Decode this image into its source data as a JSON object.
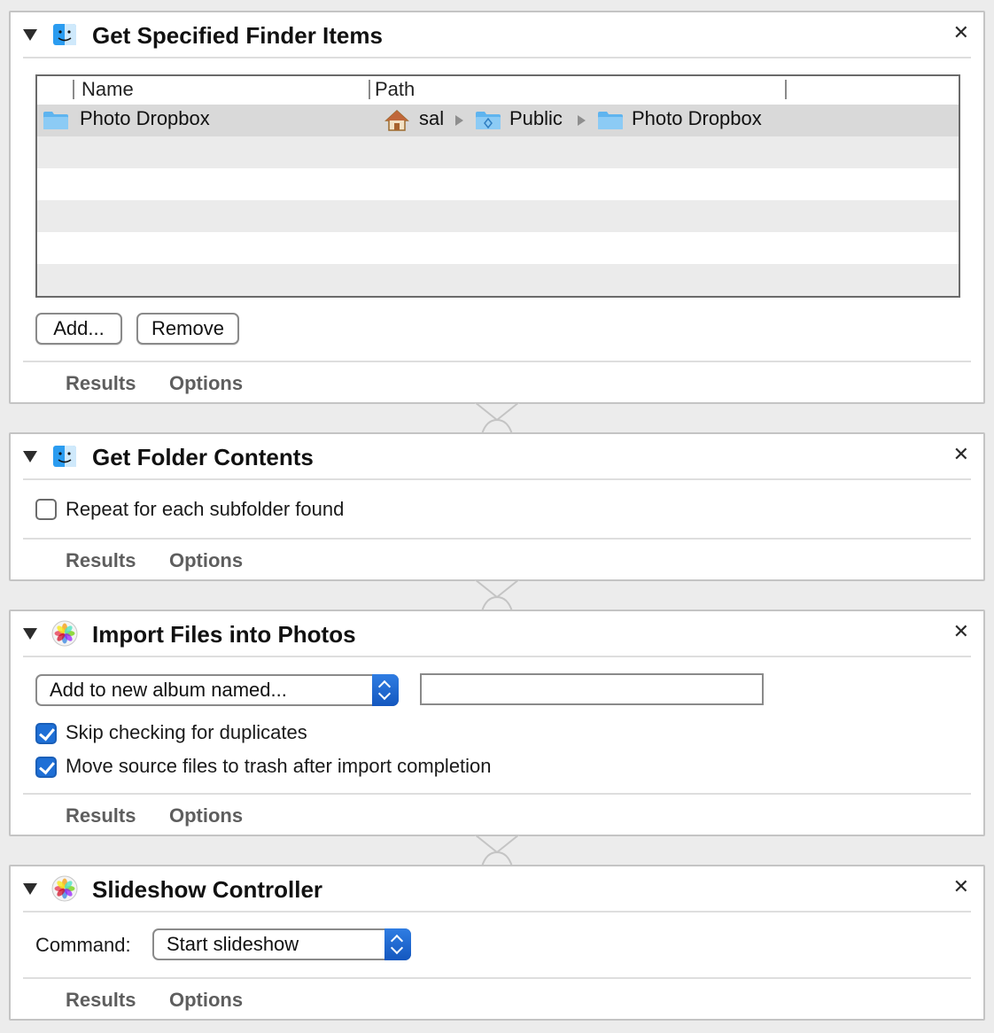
{
  "actions": [
    {
      "title": "Get Specified Finder Items",
      "table": {
        "columns": [
          "Name",
          "Path"
        ],
        "rows": [
          {
            "name": "Photo Dropbox",
            "path": [
              "sal",
              "Public",
              "Photo Dropbox"
            ]
          }
        ]
      },
      "buttons": {
        "add": "Add...",
        "remove": "Remove"
      },
      "footer": {
        "results": "Results",
        "options": "Options"
      }
    },
    {
      "title": "Get Folder Contents",
      "repeat_label": "Repeat for each subfolder found",
      "repeat_checked": false,
      "footer": {
        "results": "Results",
        "options": "Options"
      }
    },
    {
      "title": "Import Files into Photos",
      "album_popup": "Add to new album named...",
      "album_name_value": "",
      "skip_label": "Skip checking for duplicates",
      "skip_checked": true,
      "trash_label": "Move source files to trash after import completion",
      "trash_checked": true,
      "footer": {
        "results": "Results",
        "options": "Options"
      }
    },
    {
      "title": "Slideshow Controller",
      "command_label": "Command:",
      "command_value": "Start slideshow",
      "footer": {
        "results": "Results",
        "options": "Options"
      }
    }
  ],
  "colors": {
    "accent": "#1e6fd6",
    "panel_border": "#c4c4c4",
    "selected_row": "#d9d9d9"
  }
}
